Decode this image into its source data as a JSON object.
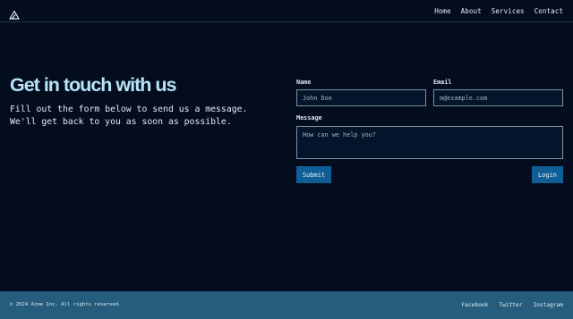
{
  "header": {
    "logo_icon": "triangle-logo-icon",
    "nav": [
      "Home",
      "About",
      "Services",
      "Contact"
    ]
  },
  "hero": {
    "title": "Get in touch with us",
    "subtitle": "Fill out the form below to send us a message. We'll get back to you as soon as possible."
  },
  "form": {
    "name_label": "Name",
    "name_placeholder": "John Doe",
    "name_value": "",
    "email_label": "Email",
    "email_placeholder": "m@example.com",
    "email_value": "",
    "message_label": "Message",
    "message_placeholder": "How can we help you?",
    "message_value": "",
    "submit_label": "Submit",
    "login_label": "Login"
  },
  "footer": {
    "copyright": "© 2024 Acme Inc. All rights reserved.",
    "links": [
      "Facebook",
      "Twitter",
      "Instagram"
    ]
  },
  "colors": {
    "background": "#030d1e",
    "accent": "#0f5e95",
    "title": "#b8e4f8",
    "footer": "#265d7c"
  }
}
